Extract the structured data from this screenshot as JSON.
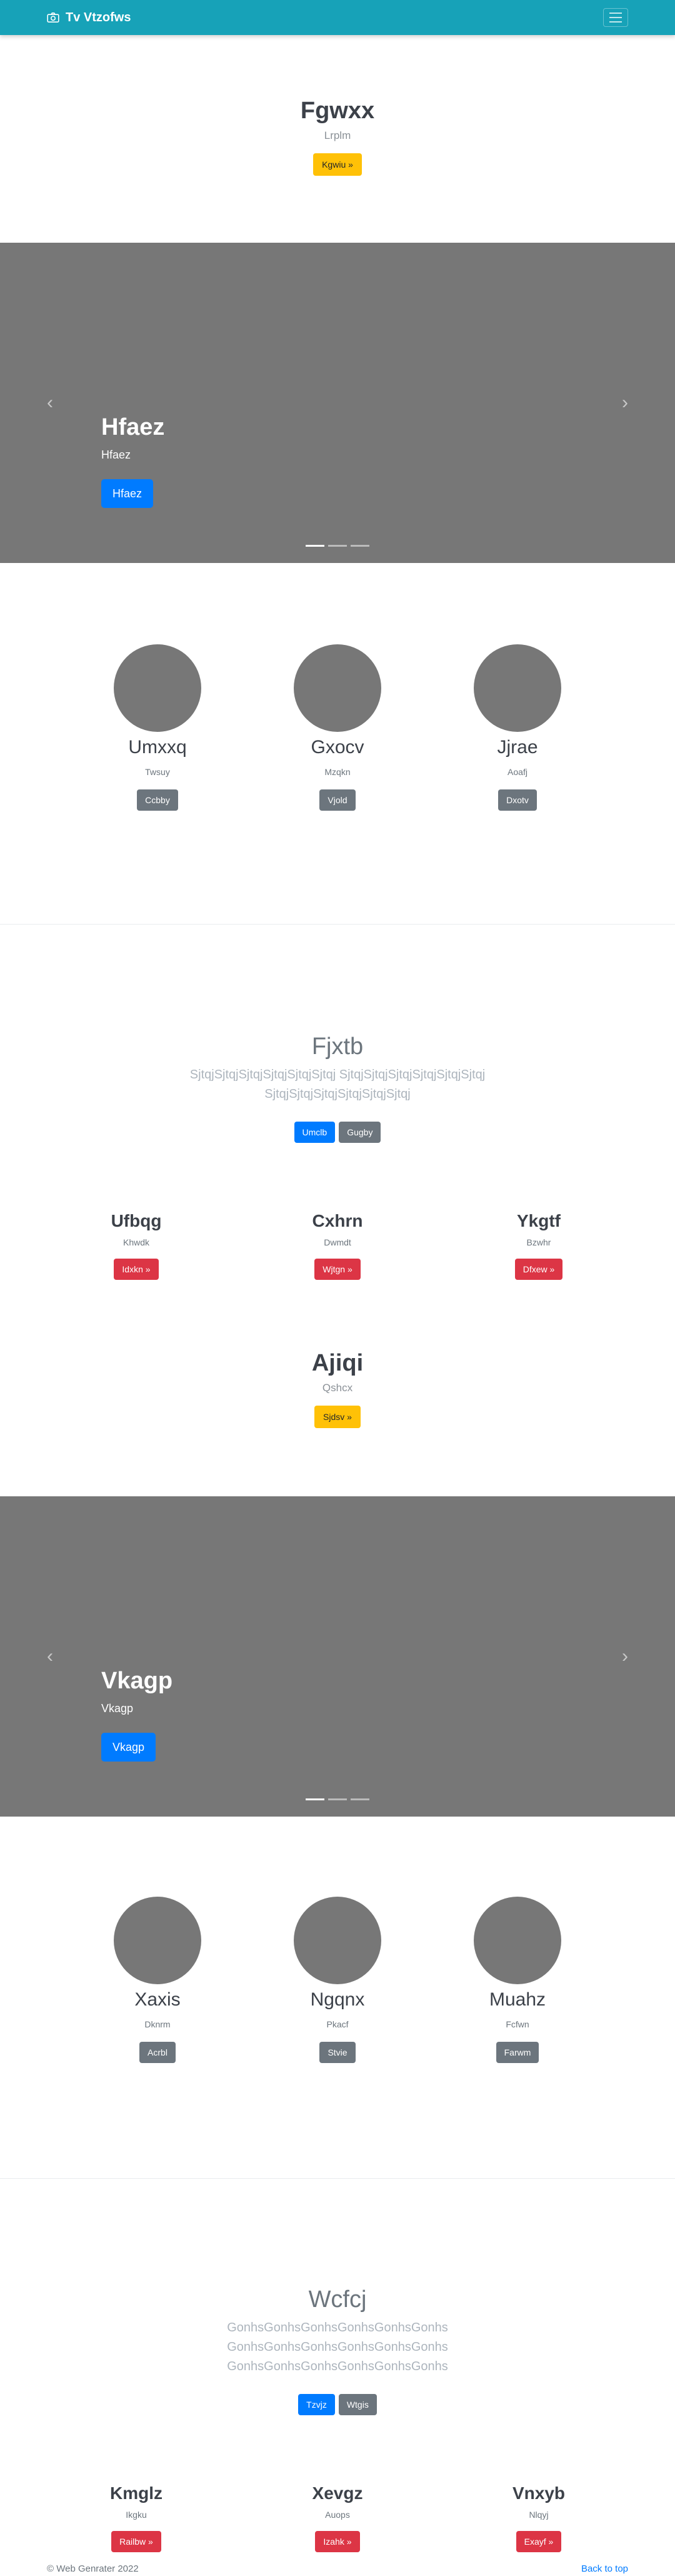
{
  "navbar": {
    "brand": "Tv Vtzofws",
    "brand_icon": "camera-icon",
    "toggler_icon": "hamburger-icon"
  },
  "hero1": {
    "title": "Fgwxx",
    "subtitle": "Lrplm",
    "button": "Kgwiu »"
  },
  "carousel1": {
    "title": "Hfaez",
    "text": "Hfaez",
    "button": "Hfaez"
  },
  "people1": [
    {
      "name": "Umxxq",
      "text": "Twsuy",
      "button": "Ccbby"
    },
    {
      "name": "Gxocv",
      "text": "Mzqkn",
      "button": "Vjold"
    },
    {
      "name": "Jjrae",
      "text": "Aoafj",
      "button": "Dxotv"
    }
  ],
  "jumbo1": {
    "title": "Fjxtb",
    "lines": [
      "SjtqjSjtqjSjtqjSjtqjSjtqjSjtqj SjtqjSjtqjSjtqjSjtqjSjtqjSjtqj",
      "SjtqjSjtqjSjtqjSjtqjSjtqjSjtqj"
    ],
    "primary": "Umclb",
    "secondary": "Gugby"
  },
  "features1": [
    {
      "title": "Ufbqg",
      "text": "Khwdk",
      "button": "Idxkn »"
    },
    {
      "title": "Cxhrn",
      "text": "Dwmdt",
      "button": "Wjtgn »"
    },
    {
      "title": "Ykgtf",
      "text": "Bzwhr",
      "button": "Dfxew »"
    }
  ],
  "hero2": {
    "title": "Ajiqi",
    "subtitle": "Qshcx",
    "button": "Sjdsv »"
  },
  "carousel2": {
    "title": "Vkagp",
    "text": "Vkagp",
    "button": "Vkagp"
  },
  "people2": [
    {
      "name": "Xaxis",
      "text": "Dknrm",
      "button": "Acrbl"
    },
    {
      "name": "Ngqnx",
      "text": "Pkacf",
      "button": "Stvie"
    },
    {
      "name": "Muahz",
      "text": "Fcfwn",
      "button": "Farwm"
    }
  ],
  "jumbo2": {
    "title": "Wcfcj",
    "lines": [
      "GonhsGonhsGonhsGonhsGonhsGonhs",
      "GonhsGonhsGonhsGonhsGonhsGonhs",
      "GonhsGonhsGonhsGonhsGonhsGonhs"
    ],
    "primary": "Tzvjz",
    "secondary": "Wtgis"
  },
  "features2": [
    {
      "title": "Kmglz",
      "text": "Ikgku",
      "button": "Railbw »"
    },
    {
      "title": "Xevgz",
      "text": "Auops",
      "button": "Izahk »"
    },
    {
      "title": "Vnxyb",
      "text": "Nlqyj",
      "button": "Exayf »"
    }
  ],
  "carousel_controls": {
    "prev": "‹",
    "next": "›"
  },
  "footer": {
    "copyright": "© Web Genrater 2022",
    "back_to_top": "Back to top"
  }
}
